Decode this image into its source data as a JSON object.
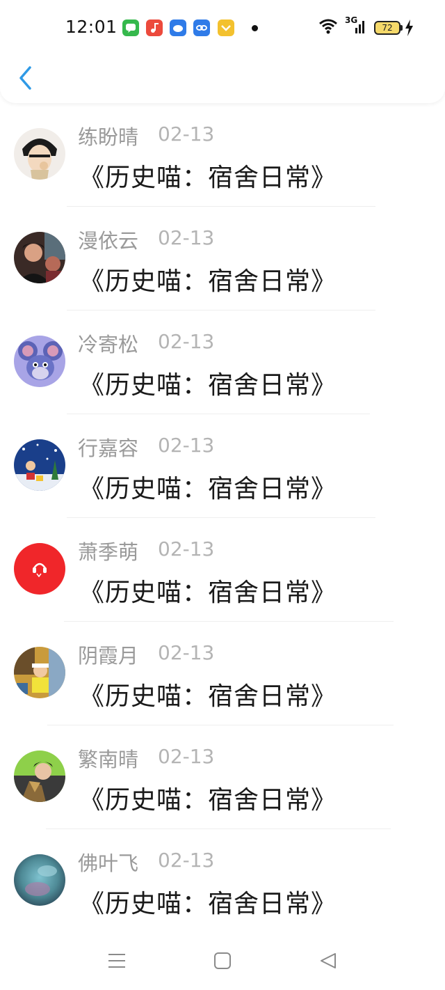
{
  "status_bar": {
    "time": "12:01",
    "network": "3G",
    "battery_level": "72",
    "battery_color": "#f5d96a",
    "app_icons": [
      "messages-icon",
      "music-icon",
      "cloud-icon",
      "link-icon",
      "wallet-icon"
    ]
  },
  "header": {
    "back_icon": "chevron-left-icon",
    "accent": "#2f9ae6"
  },
  "comments": [
    {
      "name": "练盼晴",
      "date": "02-13",
      "text": "《历史喵：宿舍日常》",
      "avatar": "anime-character-avatar"
    },
    {
      "name": "漫依云",
      "date": "02-13",
      "text": "《历史喵：宿舍日常》",
      "avatar": "photo-avatar"
    },
    {
      "name": "冷寄松",
      "date": "02-13",
      "text": "《历史喵：宿舍日常》",
      "avatar": "cartoon-mouse-avatar"
    },
    {
      "name": "行嘉容",
      "date": "02-13",
      "text": "《历史喵：宿舍日常》",
      "avatar": "christmas-scene-avatar"
    },
    {
      "name": "萧季萌",
      "date": "02-13",
      "text": "《历史喵：宿舍日常》",
      "avatar": "red-headphones-avatar"
    },
    {
      "name": "阴霞月",
      "date": "02-13",
      "text": "《历史喵：宿舍日常》",
      "avatar": "child-photo-avatar"
    },
    {
      "name": "繁南晴",
      "date": "02-13",
      "text": "《历史喵：宿舍日常》",
      "avatar": "person-green-avatar"
    },
    {
      "name": "佛叶飞",
      "date": "02-13",
      "text": "《历史喵：宿舍日常》",
      "avatar": "blurry-blue-avatar"
    }
  ],
  "navbar": {
    "icons": [
      "menu-icon",
      "home-square-icon",
      "back-triangle-icon"
    ]
  }
}
